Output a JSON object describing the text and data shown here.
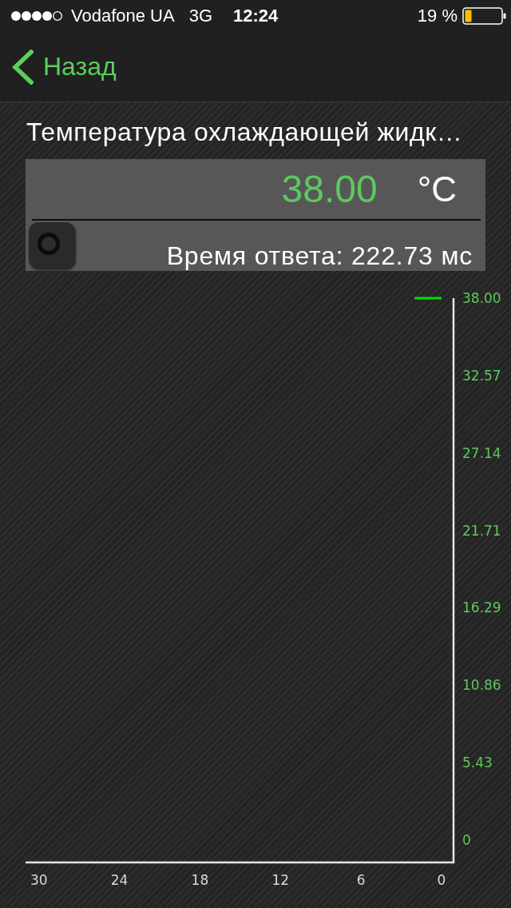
{
  "status_bar": {
    "carrier": "Vodafone UA",
    "network": "3G",
    "time": "12:24",
    "battery": "19 %"
  },
  "nav_bar": {
    "back_label": "Назад"
  },
  "sensor": {
    "title": "Температура охлаждающей жидк…",
    "value": "38.00",
    "unit": "°C",
    "response_time": "Время ответа: 222.73 мс"
  },
  "chart": {
    "chart_data": {
      "type": "line",
      "x": [
        2,
        0
      ],
      "series": [
        {
          "color": "#00e000",
          "values": [
            38,
            38
          ]
        }
      ],
      "xlim": [
        31,
        -0.9
      ],
      "ylim": [
        -1.57,
        38
      ],
      "xticks": [
        30,
        24,
        18,
        12,
        6,
        0
      ],
      "yticks": [
        {
          "value": 38,
          "label": "38.00"
        },
        {
          "value": 32.57,
          "label": "32.57"
        },
        {
          "value": 27.14,
          "label": "27.14"
        },
        {
          "value": 21.71,
          "label": "21.71"
        },
        {
          "value": 16.29,
          "label": "16.29"
        },
        {
          "value": 10.86,
          "label": "10.86"
        },
        {
          "value": 5.43,
          "label": "5.43"
        },
        {
          "value": 0,
          "label": "0"
        }
      ]
    }
  }
}
